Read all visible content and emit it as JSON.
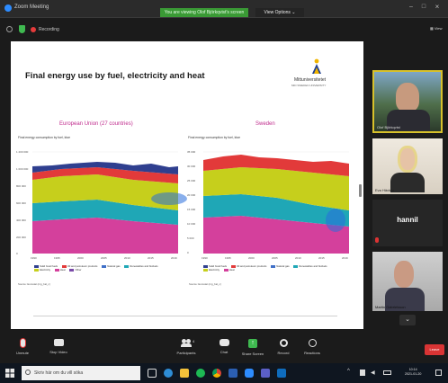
{
  "window": {
    "title": "Zoom Meeting",
    "share_banner": "You are viewing Olof Björkqvist's screen",
    "view_options": "View Options ⌄",
    "recording_label": "Recording"
  },
  "slide": {
    "title": "Final energy use by fuel, electricity and heat",
    "logo_text": "Mittuniversitetet",
    "logo_sub": "MID SWEDEN UNIVERSITY",
    "colors": {
      "title_magenta": "#c02d8e",
      "dark_blue": "#2f3f8f",
      "red": "#e23a3a",
      "yellow_green": "#c6cf1c",
      "teal": "#1fa7b6",
      "magenta": "#d4409c",
      "light_blue": "#3f6fc7"
    },
    "panels": [
      {
        "title": "European Union (27 countries)",
        "subtitle": "Final energy consumption by fuel, ktoe",
        "yticks": [
          "1 200 000",
          "1 000 000",
          "800 000",
          "600 000",
          "400 000",
          "200 000",
          "0"
        ],
        "xticks": [
          "1990",
          "1995",
          "2000",
          "2005",
          "2010",
          "2015",
          "2019"
        ],
        "legend": [
          "Solid fossil fuels",
          "Oil and petroleum products",
          "Natural gas",
          "Renewables and biofuels",
          "Electricity",
          "Heat",
          "Other"
        ],
        "source": "Source: Eurostat (nrg_bal_c)"
      },
      {
        "title": "Sweden",
        "subtitle": "Final energy consumption by fuel, ktoe",
        "yticks": [
          "35 000",
          "30 000",
          "25 000",
          "20 000",
          "15 000",
          "10 000",
          "5 000",
          "0"
        ],
        "xticks": [
          "1990",
          "1995",
          "2000",
          "2005",
          "2010",
          "2015",
          "2019"
        ],
        "legend": [
          "Solid fossil fuels",
          "Oil and petroleum products",
          "Natural gas",
          "Renewables and biofuels",
          "Electricity",
          "Heat"
        ],
        "source": "Source: Eurostat (nrg_bal_c)"
      }
    ]
  },
  "participants": [
    {
      "name": "Olof Björkqvist"
    },
    {
      "name": "Eva Häcklin"
    },
    {
      "name": "hannil"
    },
    {
      "name": "Martin Gabrielsson"
    }
  ],
  "toolbar": {
    "unmute": "Unmute",
    "stop_video": "Stop Video",
    "participants": "Participants",
    "participants_count": "4",
    "chat": "Chat",
    "share_screen": "Share Screen",
    "record": "Record",
    "reactions": "Reactions",
    "leave": "Leave"
  },
  "taskbar": {
    "search_placeholder": "Skriv här om du vill söka",
    "time": "10:14",
    "date": "2021-01-20"
  }
}
